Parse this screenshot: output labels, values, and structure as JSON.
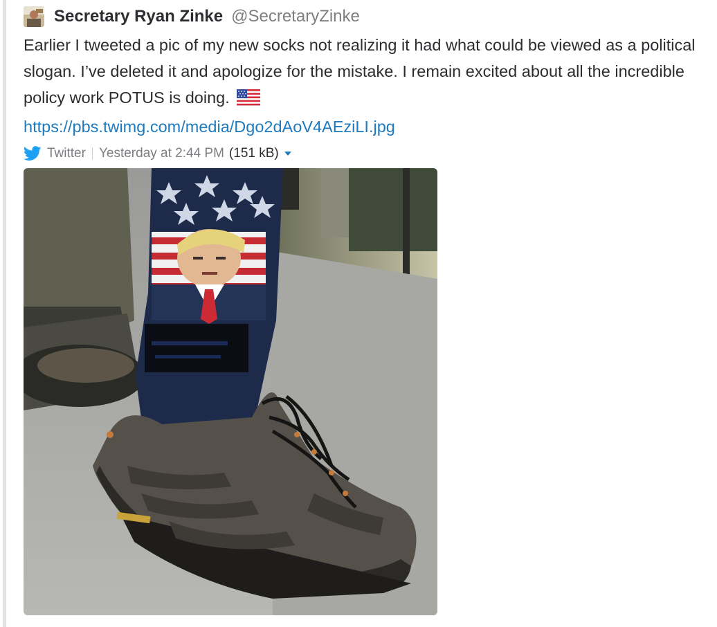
{
  "tweet": {
    "author_name": "Secretary Ryan Zinke",
    "handle": "@SecretaryZinke",
    "text": "Earlier I tweeted a pic of my new socks not realizing it had what could be viewed as a political slogan. I’ve deleted it and apologize for the mistake. I remain excited about all the incredible policy work POTUS is doing.",
    "link": "https://pbs.twimg.com/media/Dgo2dAoV4AEziLI.jpg",
    "emoji_icon": "us-flag-icon"
  },
  "meta": {
    "source": "Twitter",
    "timestamp": "Yesterday at 2:44 PM",
    "size": "(151 kB)",
    "source_icon": "twitter-bird-icon",
    "dropdown_icon": "caret-down-icon"
  },
  "colors": {
    "link": "#1f7abd",
    "twitter_blue": "#1da1f2",
    "muted_text": "#7d7e82",
    "quote_bar": "#e3e3e3"
  }
}
